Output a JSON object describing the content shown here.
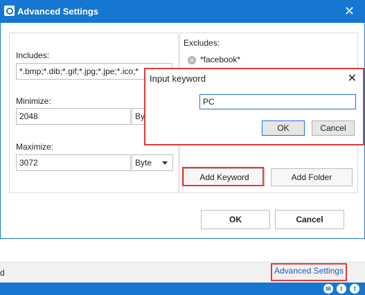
{
  "window": {
    "title": "Advanced Settings",
    "close": "✕"
  },
  "left": {
    "includes_label": "Includes:",
    "includes_value": "*.bmp;*.dib;*.gif;*.jpg;*.jpe;*.ico;*",
    "minimize_label": "Minimize:",
    "minimize_value": "2048",
    "minimize_unit": "Byte",
    "maximize_label": "Maximize:",
    "maximize_value": "3072",
    "maximize_unit": "Byte"
  },
  "right": {
    "excludes_label": "Excludes:",
    "items": [
      {
        "label": "*facebook*"
      }
    ],
    "add_keyword": "Add Keyword",
    "add_folder": "Add Folder"
  },
  "actions": {
    "ok": "OK",
    "cancel": "Cancel"
  },
  "footer": {
    "advanced_settings_link": "Advanced Settings",
    "left_fragment": "d"
  },
  "keyword_dialog": {
    "title": "Input keyword",
    "close": "✕",
    "value": "PC",
    "ok": "OK",
    "cancel": "Cancel"
  },
  "colors": {
    "accent": "#1677d2",
    "highlight": "#e53935"
  },
  "icons": [
    "app-icon",
    "close-icon",
    "remove-icon",
    "chevron-down-icon",
    "mail-icon",
    "twitter-icon",
    "facebook-icon"
  ]
}
